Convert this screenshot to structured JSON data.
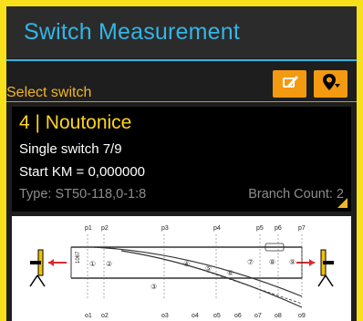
{
  "header": {
    "title": "Switch Measurement"
  },
  "section": {
    "label": "Select switch"
  },
  "toolbar": {
    "edit_icon": "edit-icon",
    "pin_icon": "map-pin-filter-icon"
  },
  "switch": {
    "title": "4 | Noutonice",
    "kind": "Single switch 7/9",
    "start_km": "Start KM = 0,000000",
    "type": "Type: ST50-118,0-1:8",
    "branch_count": "Branch Count: 2"
  },
  "diagram": {
    "top_points": [
      "p1",
      "p2",
      "p3",
      "p4",
      "p5",
      "p6",
      "p7"
    ],
    "bottom_points": [
      "o1",
      "o2",
      "o3",
      "o4",
      "o5",
      "o6",
      "o7",
      "o8",
      "o9"
    ],
    "gauge_label": "1067",
    "segment_labels": [
      "①",
      "②",
      "③",
      "④",
      "⑤",
      "⑥",
      "⑦",
      "⑧",
      "⑨"
    ]
  },
  "colors": {
    "accent_blue": "#33b5e5",
    "accent_orange": "#f39a11",
    "title_yellow": "#ffd51c",
    "border_yellow": "#f7e11a"
  }
}
